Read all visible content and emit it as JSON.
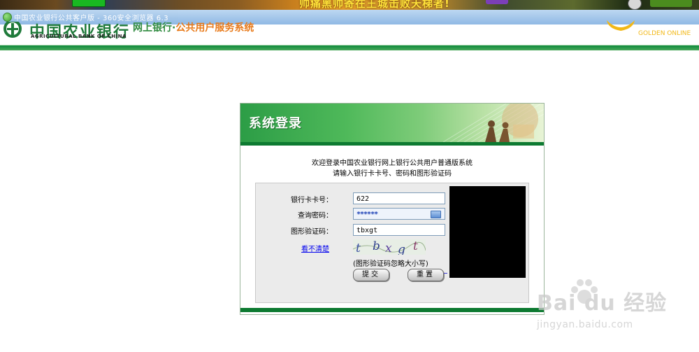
{
  "banner": {
    "headline": "帅痛黑帅寄在王城击败天梯者!"
  },
  "window": {
    "title": "中国农业银行公共客户版 - 360安全浏览器 6.3"
  },
  "bank": {
    "name_cn": "中国农业银行",
    "name_en": "AGRICULTURAL BANK OF CHINA",
    "service_prefix": "网上银行·",
    "service_name": "公共用户服务系统",
    "partner_en": "GOLDEN ONLINE",
    "colors": {
      "brand_green": "#1f7a3a",
      "accent_orange": "#e87a1a",
      "gold": "#f2b817"
    }
  },
  "login": {
    "title": "系统登录",
    "welcome_line1": "欢迎登录中国农业银行网上银行公共用户普通版系统",
    "welcome_line2": "请输入银行卡卡号、密码和图形验证码",
    "card_label": "银行卡卡号：",
    "card_value": "622",
    "password_label": "查询密码：",
    "password_value": "******",
    "captcha_label": "图形验证码：",
    "captcha_value": "tbxgt",
    "refresh_link": "看不清楚",
    "captcha_image_text": "tbxgt",
    "captcha_hint": "(图形验证码忽略大小写)",
    "submit_label": "提交",
    "reset_label": "重置",
    "icons": [
      "keyboard-icon"
    ]
  },
  "watermark": {
    "brand": "Bai du 经验",
    "url": "jingyan.baidu.com"
  }
}
